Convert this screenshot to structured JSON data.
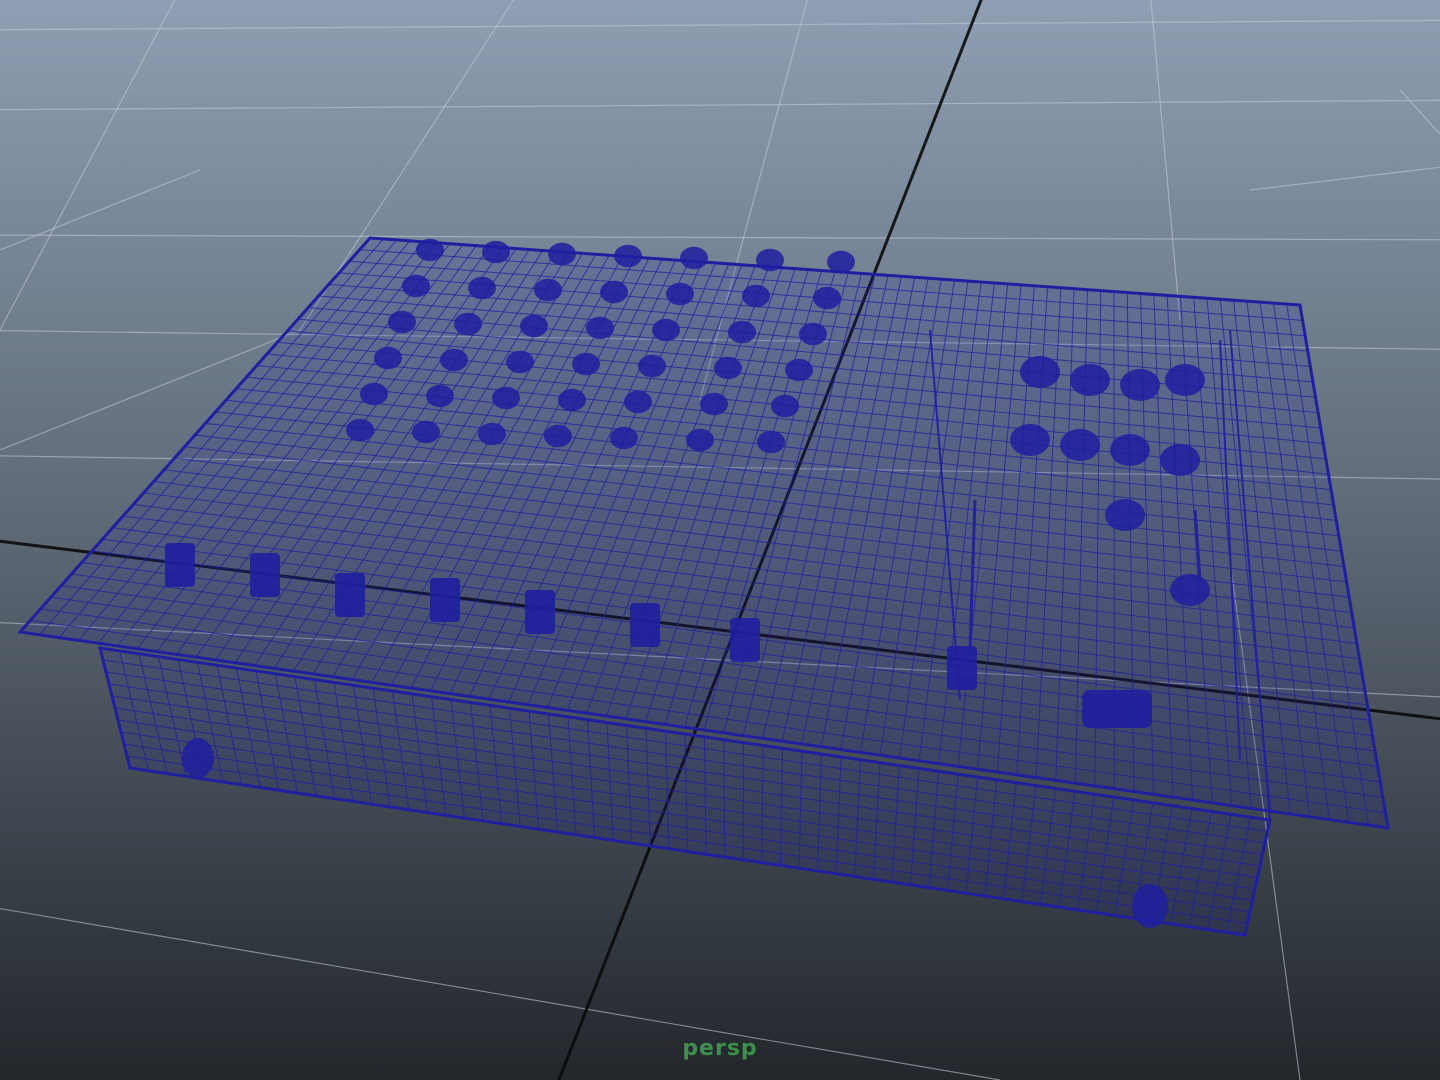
{
  "viewport": {
    "camera_name": "persp",
    "display_mode": "wireframe",
    "background_top_color": "#8e9fb3",
    "background_bottom_color": "#23272c",
    "grid_color": "#c6ced7",
    "axis_color": "#0a0a0a",
    "wireframe_color": "#1f1fa0",
    "label_color": "#3f8f4c"
  },
  "model": {
    "icon": "mixer-wireframe-icon"
  }
}
